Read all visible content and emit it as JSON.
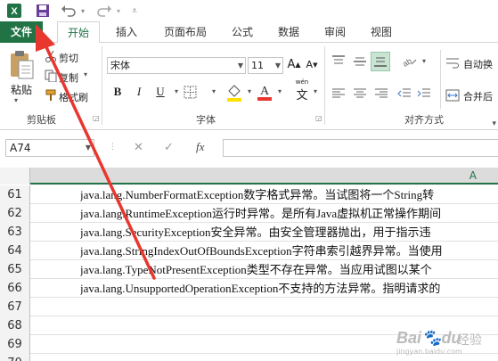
{
  "tabs": {
    "file": "文件",
    "home": "开始",
    "insert": "插入",
    "page_layout": "页面布局",
    "formulas": "公式",
    "data": "数据",
    "review": "审阅",
    "view": "视图"
  },
  "ribbon": {
    "clipboard": {
      "paste": "粘贴",
      "cut": "剪切",
      "copy": "复制",
      "format_painter": "格式刷",
      "label": "剪贴板"
    },
    "font": {
      "name": "宋体",
      "size": "11",
      "label": "字体",
      "wen": "wén",
      "wen_char": "文"
    },
    "alignment": {
      "wrap_text": "自动换",
      "merge_center": "合并后",
      "label": "对齐方式"
    }
  },
  "formula_bar": {
    "name_box": "A74",
    "cancel": "✕",
    "enter": "✓",
    "fx": "fx"
  },
  "grid": {
    "column": "A",
    "rows": [
      {
        "num": "61",
        "text": "java.lang.NumberFormatException数字格式异常。当试图将一个String转"
      },
      {
        "num": "62",
        "text": "java.lang.RuntimeException运行时异常。是所有Java虚拟机正常操作期间"
      },
      {
        "num": "63",
        "text": "java.lang.SecurityException安全异常。由安全管理器抛出，用于指示违"
      },
      {
        "num": "64",
        "text": "java.lang.StringIndexOutOfBoundsException字符串索引越界异常。当使用"
      },
      {
        "num": "65",
        "text": "java.lang.TypeNotPresentException类型不存在异常。当应用试图以某个"
      },
      {
        "num": "66",
        "text": "java.lang.UnsupportedOperationException不支持的方法异常。指明请求的"
      },
      {
        "num": "67",
        "text": ""
      },
      {
        "num": "68",
        "text": ""
      },
      {
        "num": "69",
        "text": ""
      },
      {
        "num": "70",
        "text": ""
      }
    ]
  },
  "watermark": {
    "brand": "Bai",
    "paw": "du",
    "sub": "经验",
    "url": "jingyan.baidu.com"
  },
  "colors": {
    "excel_green": "#217346",
    "annotation_red": "#e8372f"
  },
  "icons": [
    "excel-logo-icon",
    "save-icon",
    "undo-icon",
    "redo-icon",
    "customize-qat-icon",
    "paste-icon",
    "cut-icon",
    "copy-icon",
    "format-painter-icon"
  ]
}
